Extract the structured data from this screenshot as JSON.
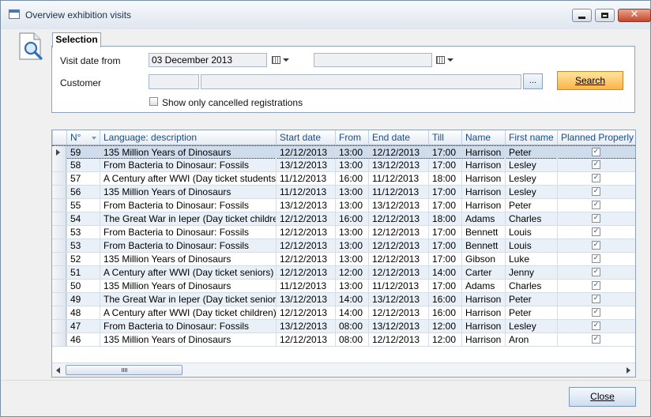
{
  "window": {
    "title": "Overview exhibition visits",
    "minimize": "minimize-icon",
    "maximize": "maximize-icon",
    "close": "✕"
  },
  "selection": {
    "tab_label": "Selection",
    "visit_date_from_label": "Visit date from",
    "visit_date_from_value": "03 December 2013",
    "visit_date_to_value": "",
    "customer_label": "Customer",
    "customer_code": "",
    "customer_name": "",
    "lookup_label": "...",
    "search_label": "Search",
    "cancelled_label": "Show only cancelled registrations",
    "cancelled_checked": false
  },
  "grid": {
    "columns": [
      "N°",
      "Language: description",
      "Start date",
      "From",
      "End date",
      "Till",
      "Name",
      "First name",
      "Planned Properly"
    ],
    "rows": [
      {
        "no": "59",
        "desc": "135 Million Years of Dinosaurs",
        "start": "12/12/2013",
        "from": "13:00",
        "end": "12/12/2013",
        "till": "17:00",
        "name": "Harrison",
        "first": "Peter",
        "planned": true
      },
      {
        "no": "58",
        "desc": "From Bacteria to Dinosaur: Fossils",
        "start": "13/12/2013",
        "from": "13:00",
        "end": "13/12/2013",
        "till": "17:00",
        "name": "Harrison",
        "first": "Lesley",
        "planned": true
      },
      {
        "no": "57",
        "desc": "A Century after WWI (Day ticket students)",
        "start": "11/12/2013",
        "from": "16:00",
        "end": "11/12/2013",
        "till": "18:00",
        "name": "Harrison",
        "first": "Lesley",
        "planned": true
      },
      {
        "no": "56",
        "desc": "135 Million Years of Dinosaurs",
        "start": "11/12/2013",
        "from": "13:00",
        "end": "11/12/2013",
        "till": "17:00",
        "name": "Harrison",
        "first": "Lesley",
        "planned": true
      },
      {
        "no": "55",
        "desc": "From Bacteria to Dinosaur: Fossils",
        "start": "13/12/2013",
        "from": "13:00",
        "end": "13/12/2013",
        "till": "17:00",
        "name": "Harrison",
        "first": "Peter",
        "planned": true
      },
      {
        "no": "54",
        "desc": "The Great War in Ieper (Day ticket children)",
        "start": "12/12/2013",
        "from": "16:00",
        "end": "12/12/2013",
        "till": "18:00",
        "name": "Adams",
        "first": "Charles",
        "planned": true
      },
      {
        "no": "53",
        "desc": "From Bacteria to Dinosaur: Fossils",
        "start": "12/12/2013",
        "from": "13:00",
        "end": "12/12/2013",
        "till": "17:00",
        "name": "Bennett",
        "first": "Louis",
        "planned": true
      },
      {
        "no": "53",
        "desc": "From Bacteria to Dinosaur: Fossils",
        "start": "12/12/2013",
        "from": "13:00",
        "end": "12/12/2013",
        "till": "17:00",
        "name": "Bennett",
        "first": "Louis",
        "planned": true
      },
      {
        "no": "52",
        "desc": "135 Million Years of Dinosaurs",
        "start": "12/12/2013",
        "from": "13:00",
        "end": "12/12/2013",
        "till": "17:00",
        "name": "Gibson",
        "first": "Luke",
        "planned": true
      },
      {
        "no": "51",
        "desc": "A Century after WWI (Day ticket seniors)",
        "start": "12/12/2013",
        "from": "12:00",
        "end": "12/12/2013",
        "till": "14:00",
        "name": "Carter",
        "first": "Jenny",
        "planned": true
      },
      {
        "no": "50",
        "desc": "135 Million Years of Dinosaurs",
        "start": "11/12/2013",
        "from": "13:00",
        "end": "11/12/2013",
        "till": "17:00",
        "name": "Adams",
        "first": "Charles",
        "planned": true
      },
      {
        "no": "49",
        "desc": "The Great War in Ieper (Day ticket seniors)",
        "start": "13/12/2013",
        "from": "14:00",
        "end": "13/12/2013",
        "till": "16:00",
        "name": "Harrison",
        "first": "Peter",
        "planned": true
      },
      {
        "no": "48",
        "desc": "A Century after WWI (Day ticket children)",
        "start": "12/12/2013",
        "from": "14:00",
        "end": "12/12/2013",
        "till": "16:00",
        "name": "Harrison",
        "first": "Peter",
        "planned": true
      },
      {
        "no": "47",
        "desc": "From Bacteria to Dinosaur: Fossils",
        "start": "13/12/2013",
        "from": "08:00",
        "end": "13/12/2013",
        "till": "12:00",
        "name": "Harrison",
        "first": "Lesley",
        "planned": true
      },
      {
        "no": "46",
        "desc": "135 Million Years of Dinosaurs",
        "start": "12/12/2013",
        "from": "08:00",
        "end": "12/12/2013",
        "till": "12:00",
        "name": "Harrison",
        "first": "Aron",
        "planned": true
      }
    ],
    "selected_row": 0,
    "scroll_grip": "|||"
  },
  "footer": {
    "close_label": "Close"
  },
  "colors": {
    "accent": "#1d4c86",
    "search_button": "#f9b548",
    "row_alt": "#e9f0f8"
  }
}
